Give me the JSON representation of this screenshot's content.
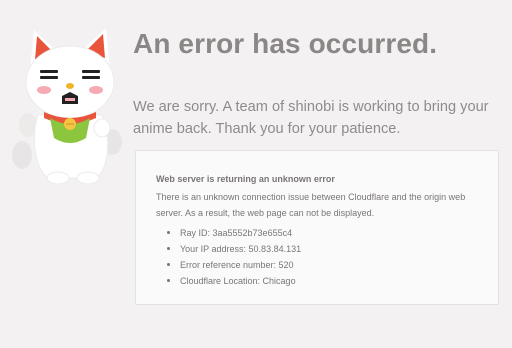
{
  "page": {
    "title": "An error has occurred.",
    "message": "We are sorry. A team of shinobi is working to bring your anime back. Thank you for your patience."
  },
  "error_card": {
    "heading": "Web server is returning an unknown error",
    "description": "There is an unknown connection issue between Cloudflare and the origin web server. As a result, the web page can not be displayed.",
    "details": [
      {
        "label": "Ray ID: 3aa5552b73e655c4"
      },
      {
        "label": "Your IP address: 50.83.84.131"
      },
      {
        "label": "Error reference number: 520"
      },
      {
        "label": "Cloudflare Location: Chicago"
      }
    ]
  },
  "mascot": {
    "icon": "maneki-neko-cat-icon",
    "colors": {
      "body": "#ffffff",
      "ears": "#e8553a",
      "collar": "#e8553a",
      "bib": "#8cc63f",
      "bell": "#f6c342",
      "blush": "#f7a9b4"
    }
  },
  "colors": {
    "background": "#f3f1f1",
    "title": "#8c8787",
    "text": "#8f8b8b",
    "card_background": "#fafafa",
    "card_border": "#e3e1e1"
  }
}
